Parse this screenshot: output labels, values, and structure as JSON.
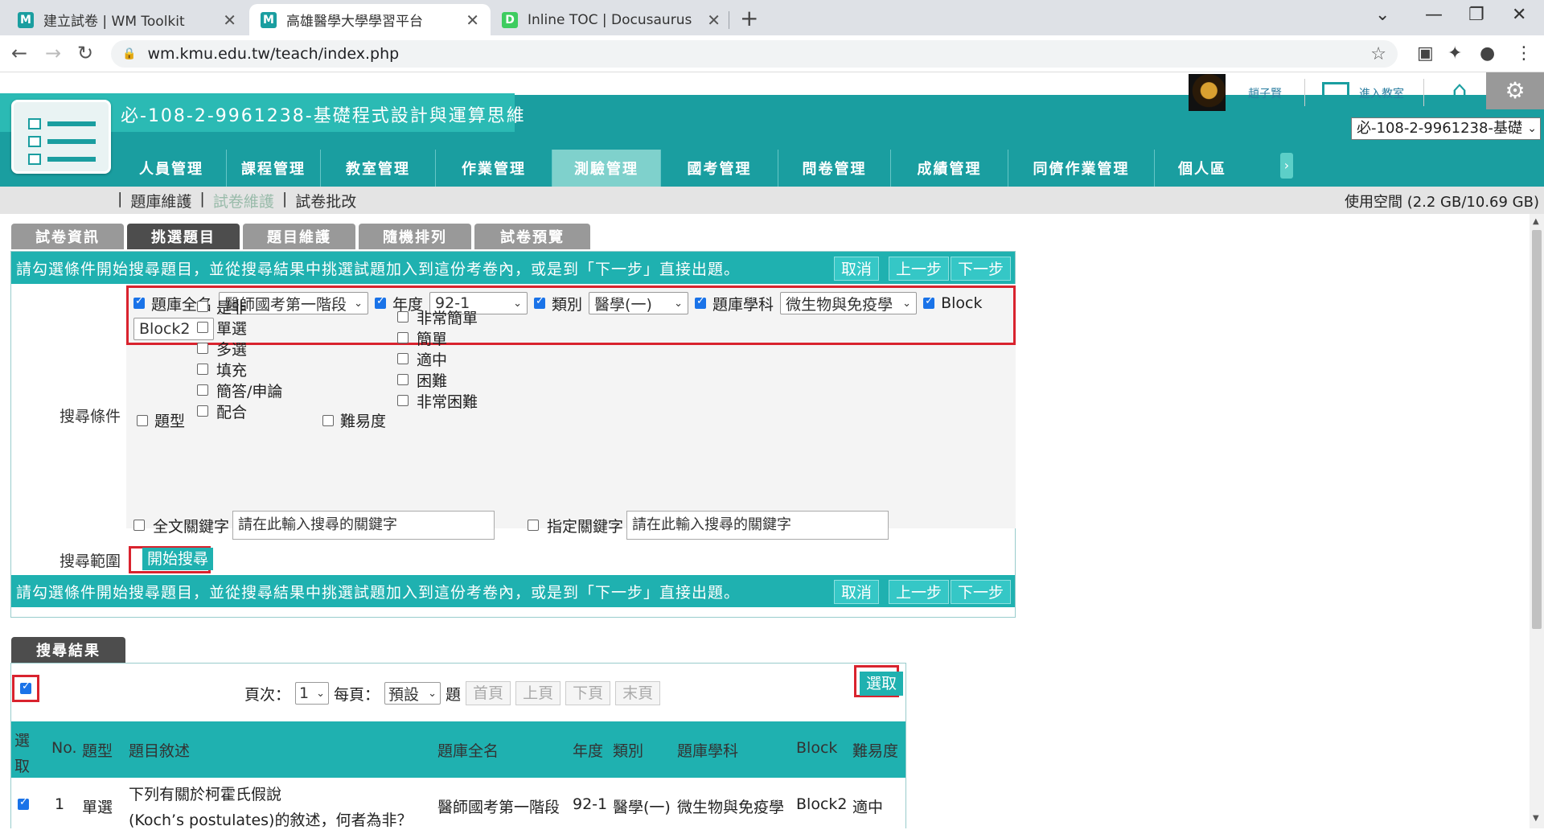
{
  "browser": {
    "tabs": [
      {
        "title": "建立試卷 | WM Toolkit",
        "favicon": "M",
        "favicon_color": "#1a9ea0"
      },
      {
        "title": "高雄醫學大學學習平台",
        "favicon": "M",
        "favicon_color": "#1a9ea0"
      },
      {
        "title": "Inline TOC | Docusaurus",
        "favicon": "D",
        "favicon_color": "#3ecc5f"
      }
    ],
    "url": "wm.kmu.edu.tw/teach/index.php"
  },
  "header": {
    "course_title": "必-108-2-9961238-基礎程式設計與運算思維",
    "user_name": "趙子賢",
    "classroom_label": "進入教室",
    "course_select": "必-108-2-9961238-基礎",
    "nav": [
      "人員管理",
      "課程管理",
      "教室管理",
      "作業管理",
      "測驗管理",
      "國考管理",
      "問卷管理",
      "成績管理",
      "同儕作業管理",
      "個人區"
    ],
    "nav_active": "測驗管理"
  },
  "subnav": {
    "links": [
      "題庫維護",
      "試卷維護",
      "試卷批改"
    ],
    "current": "試卷維護",
    "quota": "使用空間 (2.2 GB/10.69 GB)"
  },
  "steps": [
    "試卷資訊",
    "挑選題目",
    "題目維護",
    "隨機排列",
    "試卷預覽"
  ],
  "steps_active": "挑選題目",
  "search": {
    "instruction": "請勾選條件開始搜尋題目，並從搜尋結果中挑選試題加入到這份考卷內，或是到「下一步」直接出題。",
    "cancel": "取消",
    "prev": "上一步",
    "next": "下一步",
    "cond_label": "搜尋條件",
    "range_label": "搜尋範圍",
    "bank_label": "題庫全名",
    "bank_value": "醫師國考第一階段",
    "year_label": "年度",
    "year_value": "92-1",
    "category_label": "類別",
    "category_value": "醫學(一)",
    "subject_label": "題庫學科",
    "subject_value": "微生物與免疫學",
    "block_label": "Block",
    "block_value": "Block2",
    "type_label": "題型",
    "types": [
      "是非",
      "單選",
      "多選",
      "填充",
      "簡答/申論",
      "配合"
    ],
    "difficulty_label": "難易度",
    "difficulties": [
      "非常簡單",
      "簡單",
      "適中",
      "困難",
      "非常困難"
    ],
    "fulltext_label": "全文關鍵字",
    "fulltext_placeholder": "請在此輸入搜尋的關鍵字",
    "keyword_label": "指定關鍵字",
    "keyword_placeholder": "請在此輸入搜尋的關鍵字",
    "start_search": "開始搜尋"
  },
  "results": {
    "tab": "搜尋結果",
    "page_label": "頁次：",
    "page_value": "1",
    "per_page_label": "每頁：",
    "per_page_value": "預設",
    "per_page_suffix": "題",
    "first": "首頁",
    "prev": "上頁",
    "next": "下頁",
    "last": "末頁",
    "pick": "選取",
    "columns": {
      "select": "選取",
      "no": "No.",
      "type": "題型",
      "desc": "題目敘述",
      "bank": "題庫全名",
      "year": "年度",
      "category": "類別",
      "subject": "題庫學科",
      "block": "Block",
      "difficulty": "難易度"
    },
    "rows": [
      {
        "no": "1",
        "type": "單選",
        "desc_line1": "下列有關於柯霍氏假說",
        "desc_line2": "(Koch’s postulates)的敘述，何者為非？",
        "bank": "醫師國考第一階段",
        "year": "92-1",
        "category": "醫學(一)",
        "subject": "微生物與免疫學",
        "block": "Block2",
        "difficulty": "適中"
      }
    ]
  }
}
